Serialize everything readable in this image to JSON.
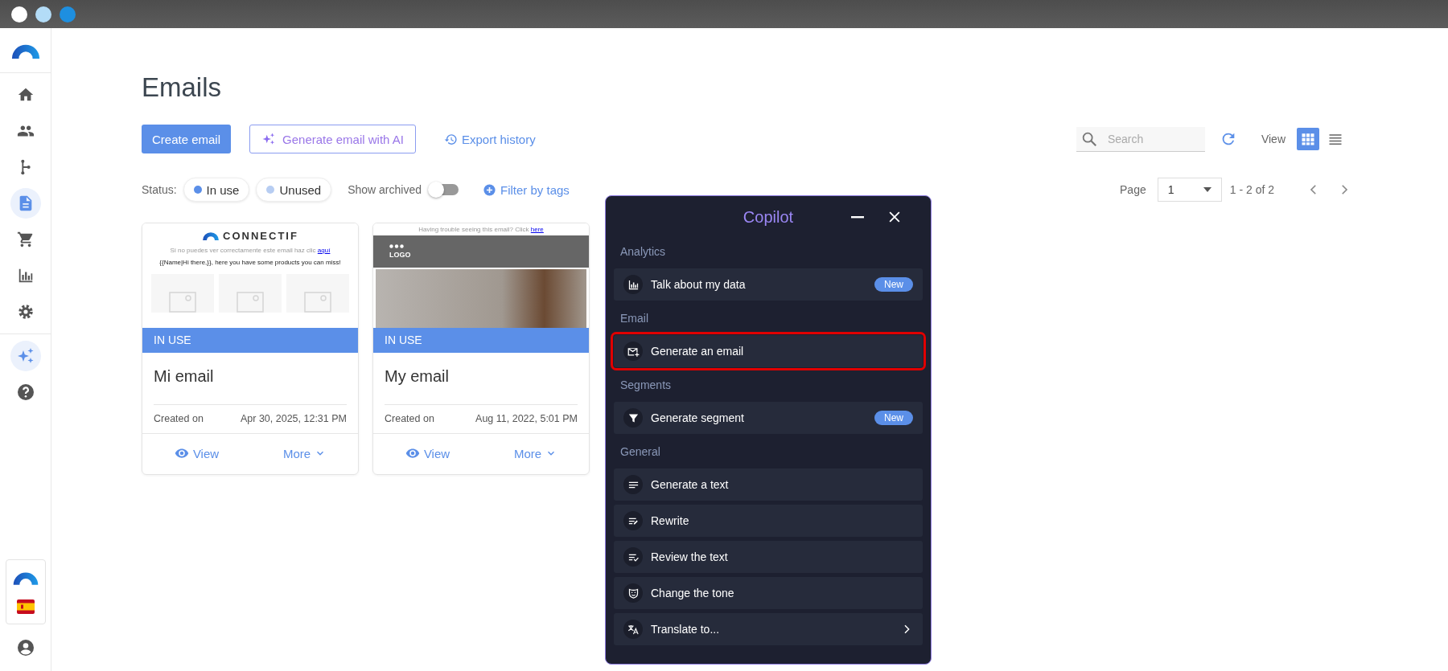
{
  "sidebar": {
    "items": [
      {
        "kind": "home",
        "selected": false
      },
      {
        "kind": "people",
        "selected": false
      },
      {
        "kind": "branch",
        "selected": false
      },
      {
        "kind": "document",
        "selected": true
      },
      {
        "kind": "cart",
        "selected": false
      },
      {
        "kind": "bar-chart",
        "selected": false
      },
      {
        "kind": "settings",
        "selected": false
      }
    ],
    "tools": [
      {
        "kind": "sparkle",
        "selected": true
      },
      {
        "kind": "help",
        "selected": false
      }
    ],
    "footer": [
      {
        "kind": "logo"
      },
      {
        "kind": "flag"
      },
      {
        "kind": "user"
      }
    ]
  },
  "page": {
    "title": "Emails"
  },
  "toolbar": {
    "create_button": "Create email",
    "ai_button": "Generate email with AI",
    "export_link": "Export history",
    "search": {
      "placeholder": "Search"
    },
    "view_label": "View",
    "view_modes": [
      {
        "kind": "grid",
        "selected": true
      },
      {
        "kind": "list",
        "selected": false
      }
    ]
  },
  "filters": {
    "status_label": "Status:",
    "statuses": [
      {
        "label": "In use",
        "color": "#5b8fe8"
      },
      {
        "label": "Unused",
        "color": "#b7cdf2"
      }
    ],
    "archived_label": "Show archived",
    "archived_on": false,
    "tags_link": "Filter by tags"
  },
  "pagination": {
    "label": "Page",
    "page": "1",
    "range": "1 - 2 of 2"
  },
  "cards": [
    {
      "thumbnail": {
        "kind": "products",
        "brand": "CONNECTIF",
        "notice": "Si no puedes ver correctamente este email haz clic",
        "notice_link": "aquí",
        "greeting": "{{Name|Hi there,}}, here you have some products you can miss!"
      },
      "status": "IN USE",
      "title": "Mi email",
      "created_label": "Created on",
      "created": "Apr 30, 2025, 12:31 PM",
      "view": "View",
      "more": "More"
    },
    {
      "thumbnail": {
        "kind": "banner",
        "notice": "Having trouble seeing this email? Click",
        "notice_link": "here",
        "logo": "LOGO"
      },
      "status": "IN USE",
      "title": "My email",
      "created_label": "Created on",
      "created": "Aug 11, 2022, 5:01 PM",
      "view": "View",
      "more": "More"
    }
  ],
  "copilot": {
    "title": "Copilot",
    "sections": [
      {
        "label": "Analytics",
        "items": [
          {
            "kind": "bar-chart",
            "label": "Talk about my data",
            "badge": "New",
            "highlighted": false,
            "submenu": false
          }
        ]
      },
      {
        "label": "Email",
        "items": [
          {
            "kind": "mail-plus",
            "label": "Generate an email",
            "highlighted": true,
            "submenu": false
          }
        ]
      },
      {
        "label": "Segments",
        "items": [
          {
            "kind": "filter",
            "label": "Generate segment",
            "badge": "New",
            "highlighted": false,
            "submenu": false
          }
        ]
      },
      {
        "label": "General",
        "items": [
          {
            "kind": "lines",
            "label": "Generate a text",
            "highlighted": false,
            "submenu": false
          },
          {
            "kind": "edit-lines",
            "label": "Rewrite",
            "highlighted": false,
            "submenu": false
          },
          {
            "kind": "check-lines",
            "label": "Review the text",
            "highlighted": false,
            "submenu": false
          },
          {
            "kind": "mask",
            "label": "Change the tone",
            "highlighted": false,
            "submenu": false
          },
          {
            "kind": "translate",
            "label": "Translate to...",
            "highlighted": false,
            "submenu": true
          }
        ]
      }
    ]
  }
}
